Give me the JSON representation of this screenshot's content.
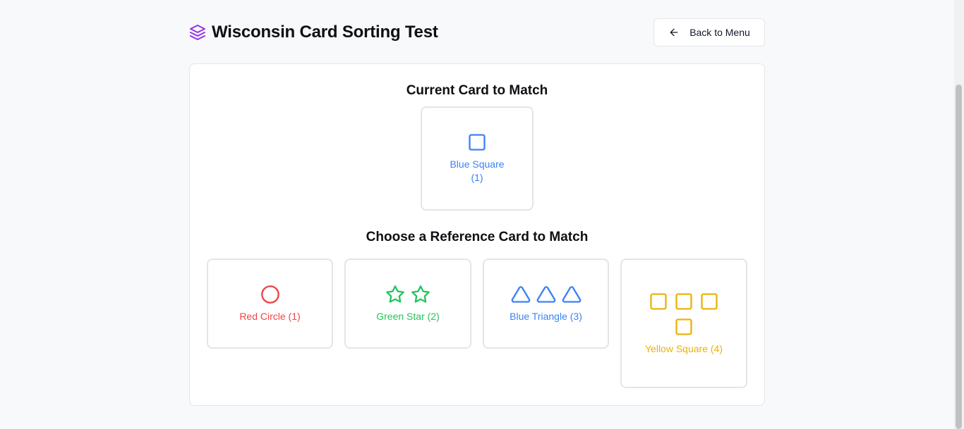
{
  "header": {
    "title": "Wisconsin Card Sorting Test",
    "title_icon": "layers-icon",
    "back_button_label": "Back to Menu",
    "back_icon": "arrow-left-icon"
  },
  "current": {
    "heading": "Current Card to Match",
    "card": {
      "label": "Blue Square (1)",
      "shape": "square",
      "count": 1,
      "color": "#3b82f6"
    }
  },
  "reference": {
    "heading": "Choose a Reference Card to Match",
    "cards": [
      {
        "label": "Red Circle (1)",
        "shape": "circle",
        "count": 1,
        "color": "#ef4444"
      },
      {
        "label": "Green Star (2)",
        "shape": "star",
        "count": 2,
        "color": "#22c55e"
      },
      {
        "label": "Blue Triangle (3)",
        "shape": "triangle",
        "count": 3,
        "color": "#3b82f6"
      },
      {
        "label": "Yellow Square (4)",
        "shape": "square",
        "count": 4,
        "color": "#eab308"
      }
    ]
  },
  "colors": {
    "accent": "#9333ea",
    "border": "#e3e5e8",
    "background": "#f8f9fb"
  }
}
